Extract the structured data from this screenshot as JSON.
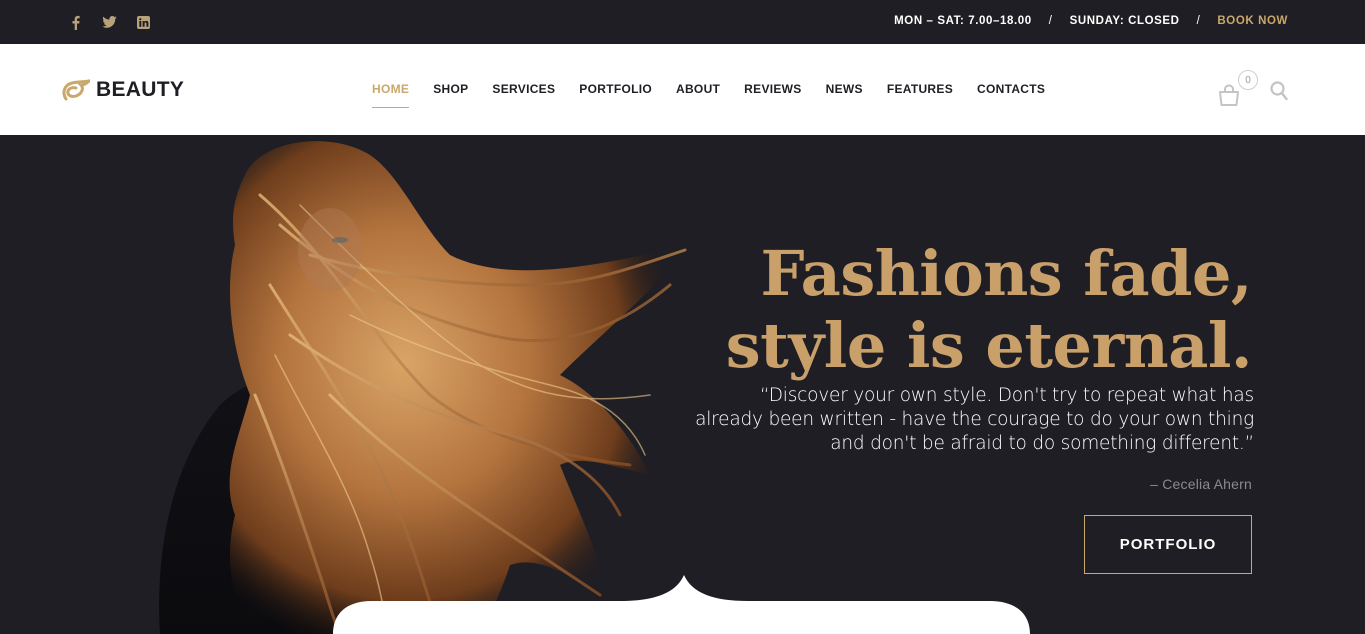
{
  "topbar": {
    "social": [
      "facebook-icon",
      "twitter-icon",
      "linkedin-icon"
    ],
    "hours": "MON – SAT: 7.00–18.00",
    "separator": "/",
    "sunday": "SUNDAY: CLOSED",
    "book_label": "BOOK NOW"
  },
  "header": {
    "logo_text": "BEAUTY",
    "nav": [
      {
        "label": "HOME",
        "active": true
      },
      {
        "label": "SHOP"
      },
      {
        "label": "SERVICES"
      },
      {
        "label": "PORTFOLIO"
      },
      {
        "label": "ABOUT"
      },
      {
        "label": "REVIEWS"
      },
      {
        "label": "NEWS"
      },
      {
        "label": "FEATURES"
      },
      {
        "label": "CONTACTS"
      }
    ],
    "cart_count": "0"
  },
  "hero": {
    "headline_line1": "Fashions fade,",
    "headline_line2": "style is eternal.",
    "quote": "“Discover your own style. Don't try to repeat what has already been written - have the courage to do your own thing and don't be afraid to do something different.”",
    "author": "– Cecelia Ahern",
    "button_label": "PORTFOLIO"
  },
  "colors": {
    "accent": "#c9a86c",
    "dark": "#1f1e24",
    "headline": "#c9a06a"
  }
}
